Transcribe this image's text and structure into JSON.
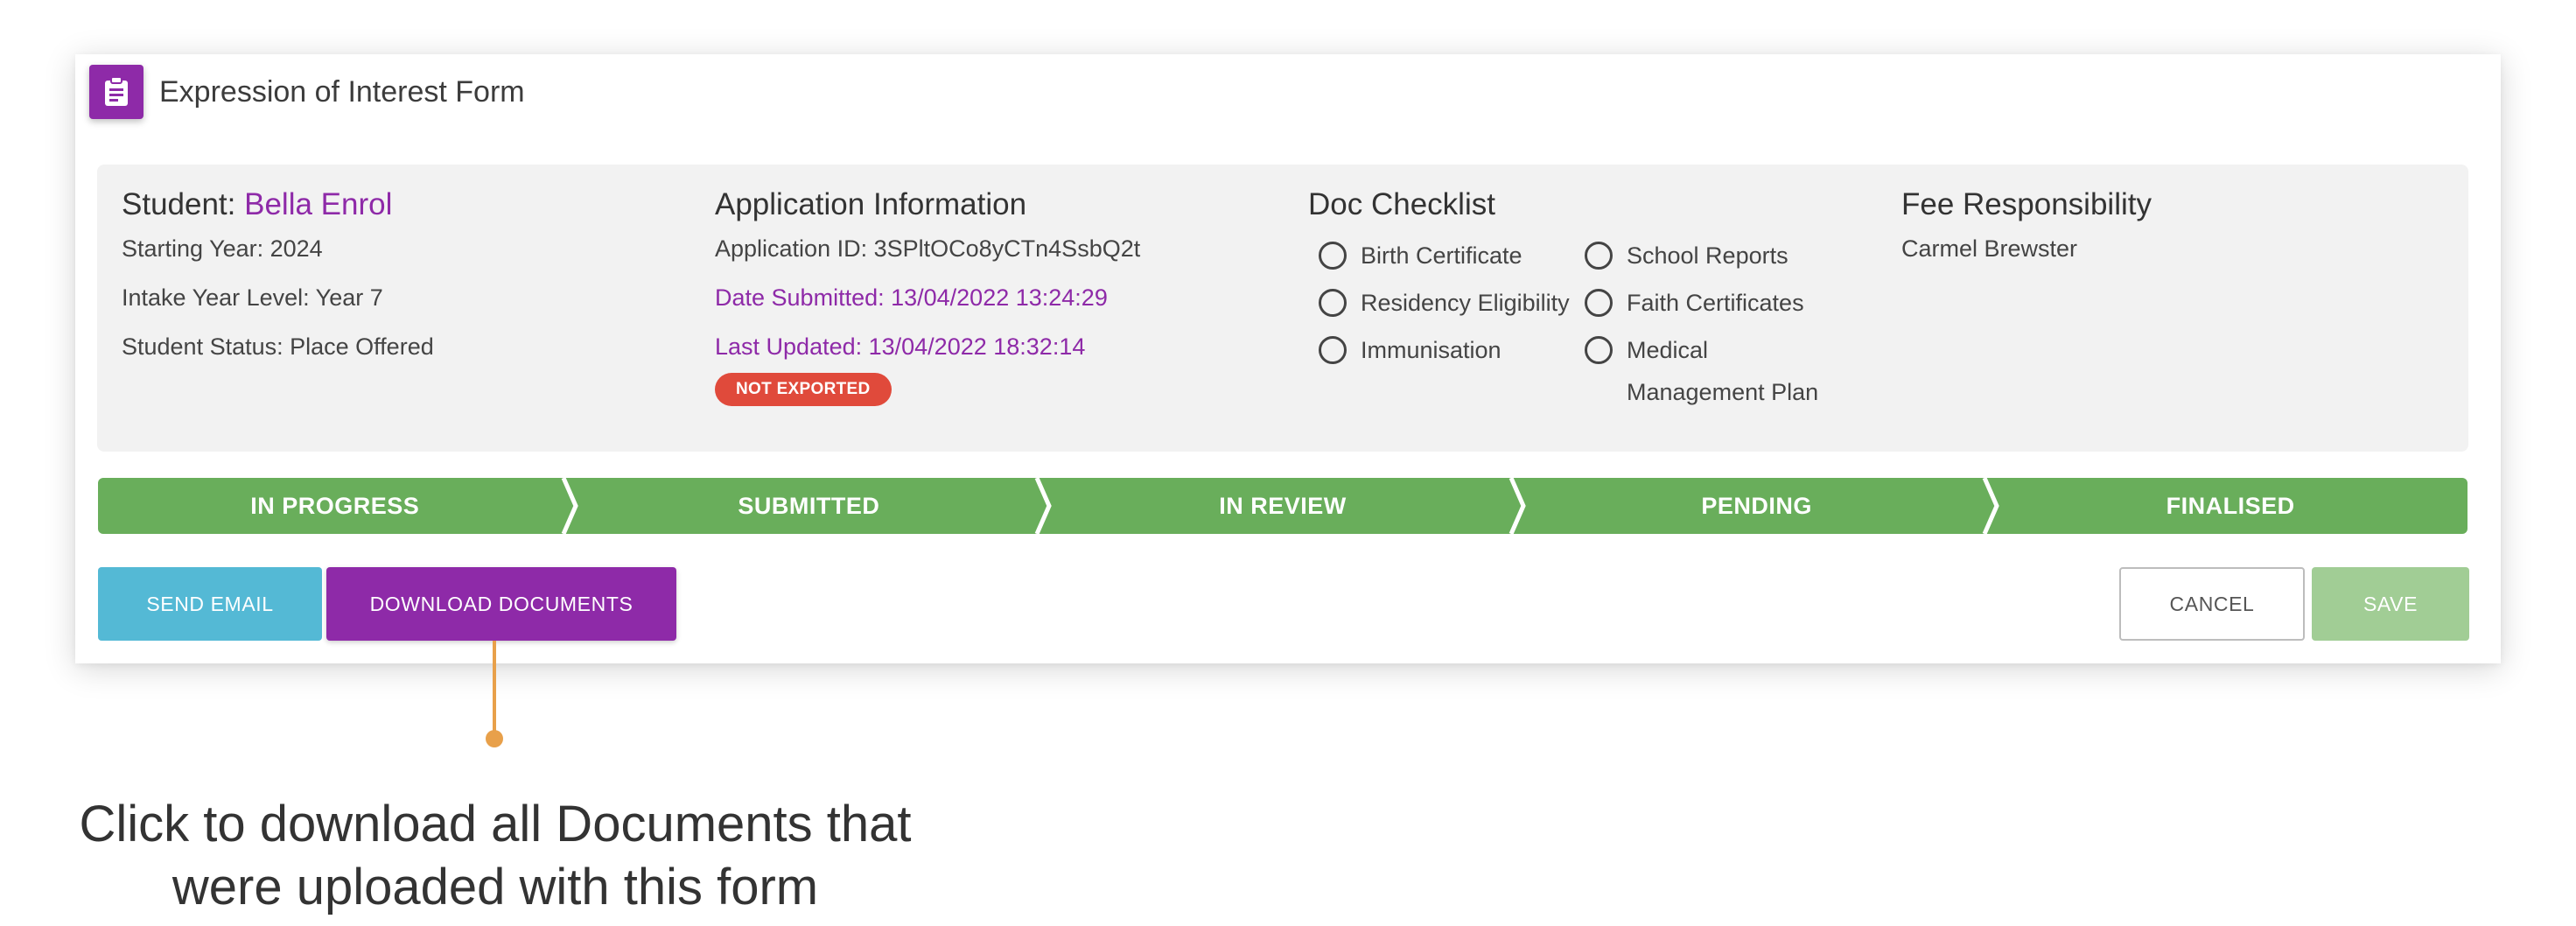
{
  "form": {
    "title": "Expression of Interest Form",
    "icon": "clipboard-icon",
    "accent_color": "#8e2aa8"
  },
  "student": {
    "label": "Student:",
    "name": "Bella Enrol",
    "starting_year": "Starting Year: 2024",
    "intake_year_level": "Intake Year Level: Year 7",
    "status": "Student Status: Place Offered"
  },
  "application": {
    "heading": "Application Information",
    "id": "Application ID: 3SPltOCo8yCTn4SsbQ2t",
    "date_submitted": "Date Submitted: 13/04/2022 13:24:29",
    "last_updated": "Last Updated: 13/04/2022 18:32:14",
    "export_badge": "NOT EXPORTED",
    "badge_color": "#e04a3b"
  },
  "doc_checklist": {
    "heading": "Doc Checklist",
    "items": [
      {
        "label": "Birth Certificate",
        "checked": false
      },
      {
        "label": "Residency Eligibility",
        "checked": false
      },
      {
        "label": "Immunisation",
        "checked": false
      },
      {
        "label": "School Reports",
        "checked": false
      },
      {
        "label": "Faith Certificates",
        "checked": false
      },
      {
        "label": "Medical Management Plan",
        "checked": false
      }
    ]
  },
  "fee": {
    "heading": "Fee Responsibility",
    "name": "Carmel Brewster"
  },
  "progress": {
    "color": "#69ae5b",
    "steps": [
      "IN PROGRESS",
      "SUBMITTED",
      "IN REVIEW",
      "PENDING",
      "FINALISED"
    ]
  },
  "actions": {
    "send_email": "SEND EMAIL",
    "download_documents": "DOWNLOAD DOCUMENTS",
    "cancel": "CANCEL",
    "save": "SAVE"
  },
  "callout": {
    "text": "Click to download all Documents that were uploaded with this form",
    "color": "#e8a04a"
  }
}
